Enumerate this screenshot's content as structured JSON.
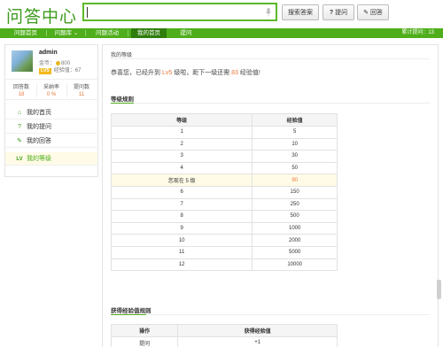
{
  "header": {
    "logo": "问答中心",
    "search_value": "",
    "search_button": "搜索答案",
    "ask_button": "提问",
    "answer_button": "回答"
  },
  "nav": {
    "items": [
      "问题首页",
      "问题库",
      "问题活动",
      "我的首页",
      "提问"
    ],
    "active_index": 3,
    "right_text": "累计提问：13"
  },
  "sidebar": {
    "username": "admin",
    "gold_label": "金币：",
    "gold_value": "800",
    "level_badge": "LV5",
    "exp_label": "经验值：",
    "exp_value": "67",
    "stats": [
      {
        "label": "回答数",
        "value": "18"
      },
      {
        "label": "采纳率",
        "value": "0 %"
      },
      {
        "label": "提问数",
        "value": "11"
      }
    ],
    "menu": [
      {
        "label": "我的首页",
        "icon": "home-icon",
        "glyph": "⌂"
      },
      {
        "label": "我的提问",
        "icon": "question-icon",
        "glyph": "?"
      },
      {
        "label": "我的回答",
        "icon": "user-answer-icon",
        "glyph": "✎"
      },
      {
        "label": "我的等级",
        "icon": "level-icon",
        "glyph": "LV"
      }
    ],
    "active_menu": 3
  },
  "main": {
    "breadcrumb": "我的等级",
    "congrats_pre": "恭喜您，已经升到 ",
    "congrats_level": "Lv5",
    "congrats_mid": " 级啦，距下一级还需 ",
    "congrats_need": "83",
    "congrats_post": " 经验值!",
    "level_rules_title": "等级规则",
    "level_table": {
      "headers": [
        "等级",
        "经验值"
      ],
      "rows": [
        [
          "1",
          "5"
        ],
        [
          "2",
          "10"
        ],
        [
          "3",
          "30"
        ],
        [
          "4",
          "50"
        ],
        [
          "您现在 5 级",
          "90"
        ],
        [
          "6",
          "150"
        ],
        [
          "7",
          "250"
        ],
        [
          "8",
          "500"
        ],
        [
          "9",
          "1000"
        ],
        [
          "10",
          "2000"
        ],
        [
          "11",
          "5000"
        ],
        [
          "12",
          "10000"
        ]
      ],
      "current_row": 4
    },
    "exp_rules_title": "获得经验值规则",
    "exp_table": {
      "headers": [
        "操作",
        "获得经验值"
      ],
      "rows": [
        [
          "提问",
          "+1"
        ]
      ]
    }
  },
  "colors": {
    "brand_green": "#4eae1b",
    "active_green": "#2f7d0c",
    "highlight_orange": "#e8773a"
  }
}
